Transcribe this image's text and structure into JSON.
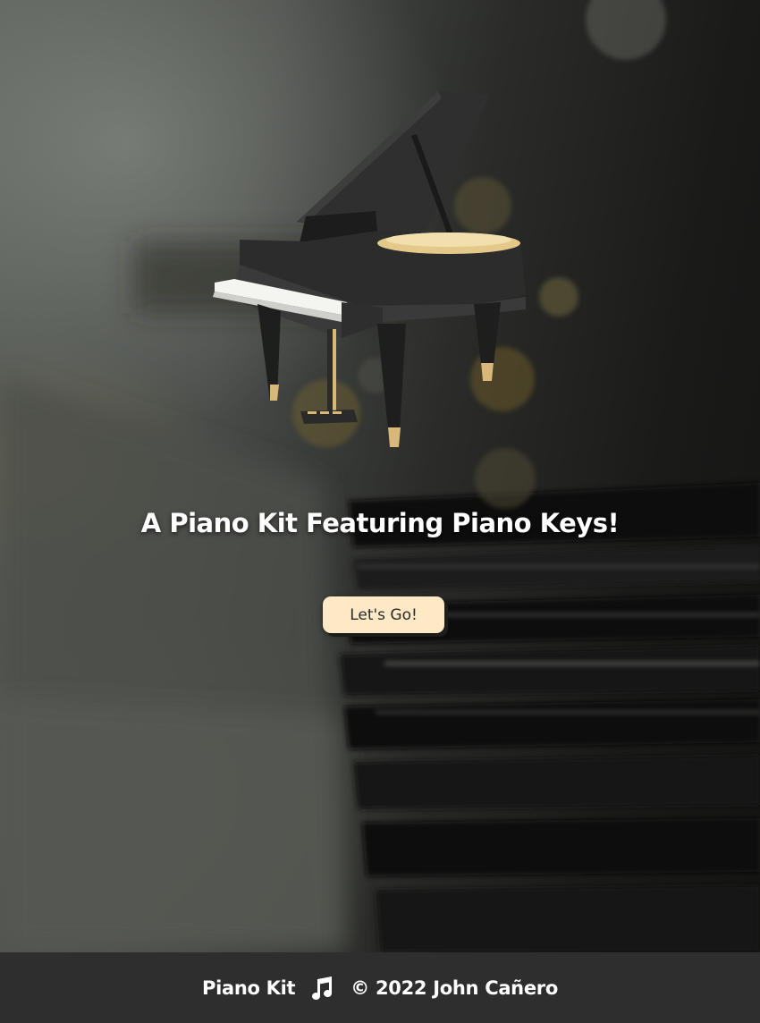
{
  "hero": {
    "tagline": "A Piano Kit Featuring Piano Keys!",
    "cta_label": "Let's Go!",
    "illustration_icon": "grand-piano-icon"
  },
  "footer": {
    "brand": "Piano Kit",
    "icon": "music-note-icon",
    "copyright": "© 2022 John Cañero"
  },
  "colors": {
    "button_bg": "#fde9c6",
    "footer_bg": "#2e2e2e",
    "text": "#ffffff"
  }
}
